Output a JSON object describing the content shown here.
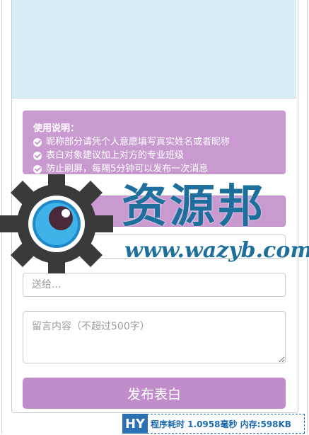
{
  "notice": {
    "title": "使用说明：",
    "items": [
      "昵称部分请凭个人意愿填写真实姓名或者昵称",
      "表白对象建议加上对方的专业班级",
      "防止刷屏，每隔5分钟可以发布一次消息"
    ]
  },
  "form": {
    "nickname_placeholder": "昵称...",
    "to_placeholder": "送给...",
    "message_placeholder": "留言内容（不超过500字）",
    "submit_label": "发布表白"
  },
  "watermark": {
    "title": "资源邦",
    "url": "www.wazyb.com"
  },
  "footer": {
    "badge": "HY",
    "stats": "程序耗时 1.0958毫秒 内存:598KB"
  },
  "colors": {
    "accent": "#c18cca",
    "cover": "#d7ecf5",
    "watermark": "#1f6f9c"
  }
}
